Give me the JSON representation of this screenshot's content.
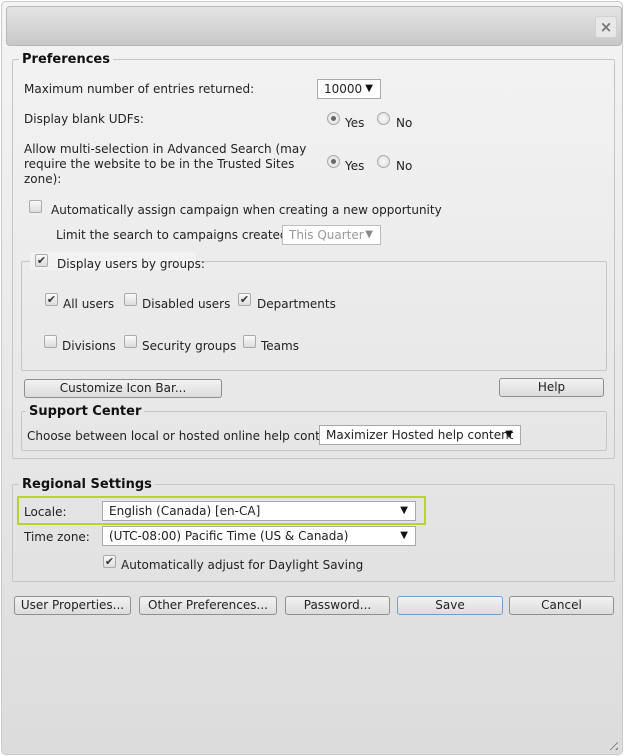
{
  "dialog": {
    "close_icon": "×"
  },
  "preferences": {
    "legend": "Preferences",
    "max_entries": {
      "label": "Maximum number of entries returned:",
      "value": "10000"
    },
    "display_blank_udfs": {
      "label": "Display blank UDFs:",
      "yes": "Yes",
      "no": "No",
      "selected": "Yes"
    },
    "multi_selection": {
      "label_line1": "Allow multi-selection in Advanced Search (may",
      "label_line2": "require the website to be in the Trusted Sites",
      "label_line3": "zone):",
      "yes": "Yes",
      "no": "No",
      "selected": "Yes"
    },
    "auto_assign_campaign": {
      "label": "Automatically assign campaign when creating a new opportunity",
      "checked": false
    },
    "limit_search": {
      "label": "Limit the search to campaigns created:",
      "value": "This Quarter",
      "disabled": true
    },
    "display_users_by_groups": {
      "label": "Display users by groups:",
      "checked": true,
      "options": [
        {
          "label": "All users",
          "checked": true
        },
        {
          "label": "Disabled users",
          "checked": false
        },
        {
          "label": "Departments",
          "checked": true
        },
        {
          "label": "Divisions",
          "checked": false
        },
        {
          "label": "Security groups",
          "checked": false
        },
        {
          "label": "Teams",
          "checked": false
        }
      ]
    },
    "customize_icon_bar_label": "Customize Icon Bar...",
    "help_label": "Help",
    "support_center": {
      "legend": "Support Center",
      "label": "Choose between local or hosted online help content:",
      "value": "Maximizer Hosted help content"
    }
  },
  "regional": {
    "legend": "Regional Settings",
    "locale": {
      "label": "Locale:",
      "value": "English (Canada) [en-CA]"
    },
    "timezone": {
      "label": "Time zone:",
      "value": "(UTC-08:00) Pacific Time (US & Canada)"
    },
    "daylight_saving": {
      "label": "Automatically adjust for Daylight Saving",
      "checked": true
    }
  },
  "buttons": {
    "user_properties": "User Properties...",
    "other_preferences": "Other Preferences...",
    "password": "Password...",
    "save": "Save",
    "cancel": "Cancel"
  },
  "icons": {
    "check": "✔",
    "dropdown_arrow": "▼"
  },
  "colors": {
    "highlight": "#b7d334",
    "primary_button_border": "#6ea0d8"
  }
}
